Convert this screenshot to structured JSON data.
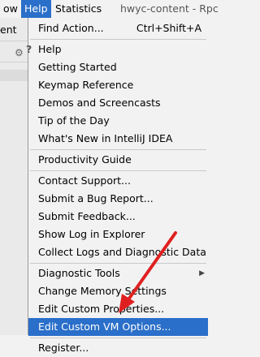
{
  "menubar": {
    "prev_menu": "ow",
    "help": "Help",
    "statistics": "Statistics",
    "title": "hwyc-content - Rpc"
  },
  "background": {
    "left_label": "ent"
  },
  "menu": {
    "items": [
      {
        "label": "Find Action...",
        "shortcut": "Ctrl+Shift+A"
      },
      {
        "label": "Help"
      },
      {
        "label": "Getting Started"
      },
      {
        "label": "Keymap Reference"
      },
      {
        "label": "Demos and Screencasts"
      },
      {
        "label": "Tip of the Day"
      },
      {
        "label": "What's New in IntelliJ IDEA"
      },
      {
        "label": "Productivity Guide"
      },
      {
        "label": "Contact Support..."
      },
      {
        "label": "Submit a Bug Report..."
      },
      {
        "label": "Submit Feedback..."
      },
      {
        "label": "Show Log in Explorer"
      },
      {
        "label": "Collect Logs and Diagnostic Data"
      },
      {
        "label": "Diagnostic Tools"
      },
      {
        "label": "Change Memory Settings"
      },
      {
        "label": "Edit Custom Properties..."
      },
      {
        "label": "Edit Custom VM Options..."
      },
      {
        "label": "Register..."
      }
    ],
    "help_glyph": "?",
    "submenu_glyph": "▶"
  },
  "colors": {
    "selection": "#2a6fc9",
    "annotation_arrow": "#e02020"
  }
}
